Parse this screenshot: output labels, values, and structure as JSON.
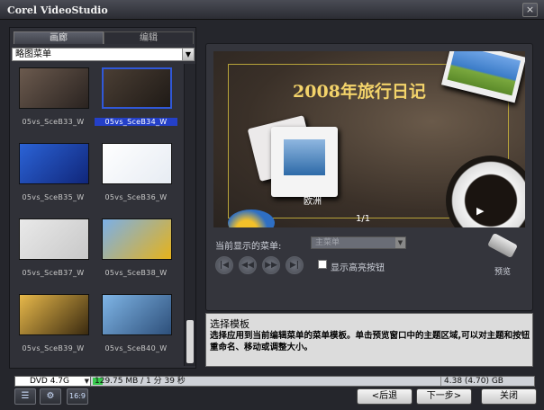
{
  "window": {
    "title": "Corel VideoStudio",
    "close_glyph": "×"
  },
  "library": {
    "tabs": [
      {
        "label": "画廊"
      },
      {
        "label": "编辑"
      }
    ],
    "menu_select": "略图菜单",
    "thumbnails": [
      {
        "name": "05vs_SceB33_W",
        "selected": false,
        "colors": [
          "#6b5a4e",
          "#2a2320"
        ]
      },
      {
        "name": "05vs_SceB34_W",
        "selected": true,
        "colors": [
          "#4a3e34",
          "#1f1a16"
        ]
      },
      {
        "name": "05vs_SceB35_W",
        "selected": false,
        "colors": [
          "#2b63d6",
          "#10267a"
        ]
      },
      {
        "name": "05vs_SceB36_W",
        "selected": false,
        "colors": [
          "#ffffff",
          "#e7ecf3"
        ]
      },
      {
        "name": "05vs_SceB37_W",
        "selected": false,
        "colors": [
          "#e9e9e9",
          "#c8c8c8"
        ]
      },
      {
        "name": "05vs_SceB38_W",
        "selected": false,
        "colors": [
          "#7bb0e8",
          "#e6b21a"
        ]
      },
      {
        "name": "05vs_SceB39_W",
        "selected": false,
        "colors": [
          "#e7b84a",
          "#3a2a10"
        ]
      },
      {
        "name": "05vs_SceB40_W",
        "selected": false,
        "colors": [
          "#7fb5e6",
          "#2d4f7a"
        ]
      }
    ]
  },
  "preview": {
    "title": "2008年旅行日记",
    "caption": "欧洲",
    "page": "1/1",
    "play_glyph": "▶",
    "menu_label": "当前显示的菜单:",
    "menu_value": "主菜单",
    "nav_buttons": [
      {
        "glyph": "|◀"
      },
      {
        "glyph": "◀◀"
      },
      {
        "glyph": "▶▶"
      },
      {
        "glyph": "▶|"
      }
    ],
    "highlight_label": "显示高亮按钮",
    "remote_label": "预览"
  },
  "description": {
    "title": "选择模板",
    "text": "选择应用到当前编辑菜单的菜单模板。单击预览窗口中的主题区域,可以对主题和按钮重命名、移动或调整大小。"
  },
  "status": {
    "disc": "DVD 4.7G",
    "usage": "129.75 MB / 1 分 39 秒",
    "usage_fraction": 0.03,
    "capacity": "4.38 (4.70) GB"
  },
  "toolbar": {
    "list": "☰",
    "settings": "⚙",
    "ratio": "16:9"
  },
  "buttons": {
    "back": "<后退",
    "next": "下一步>",
    "close": "关闭"
  }
}
